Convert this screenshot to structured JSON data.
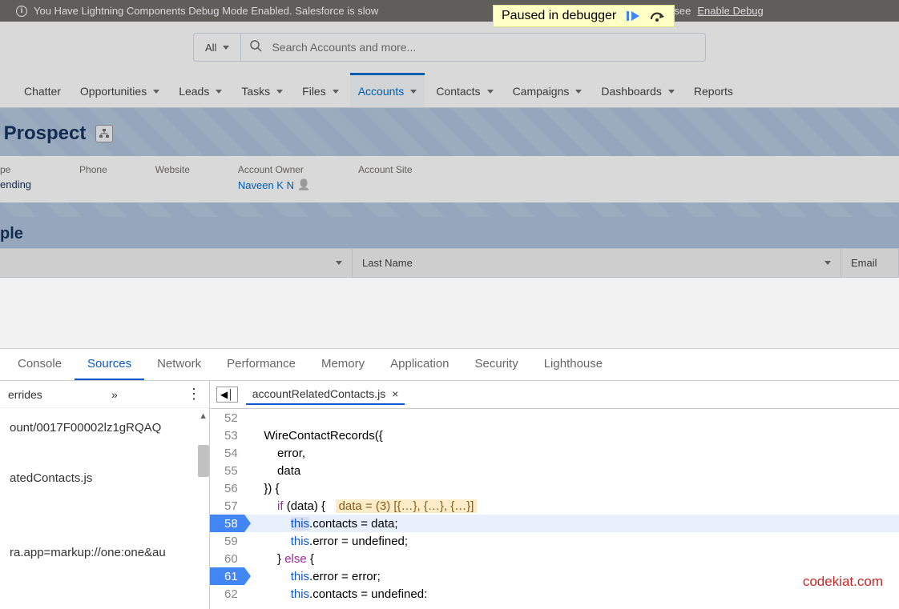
{
  "banner": {
    "text_left": "You Have Lightning Components Debug Mode Enabled. Salesforce is slow",
    "text_right": "w to disable it, or see",
    "link": "Enable Debug"
  },
  "debugger": {
    "label": "Paused in debugger"
  },
  "search": {
    "scope": "All",
    "placeholder": "Search Accounts and more..."
  },
  "nav": {
    "items": [
      "Chatter",
      "Opportunities",
      "Leads",
      "Tasks",
      "Files",
      "Accounts",
      "Contacts",
      "Campaigns",
      "Dashboards",
      "Reports"
    ],
    "active": "Accounts"
  },
  "record": {
    "title_suffix": "t Prospect",
    "details": [
      {
        "label": "pe",
        "value": "ending"
      },
      {
        "label": "Phone",
        "value": ""
      },
      {
        "label": "Website",
        "value": ""
      },
      {
        "label": "Account Owner",
        "value": "Naveen K N",
        "link": true
      },
      {
        "label": "Account Site",
        "value": ""
      }
    ]
  },
  "related": {
    "title_suffix": "ple",
    "columns": [
      "",
      "Last Name",
      "Email"
    ]
  },
  "devtools": {
    "tabs": [
      "Console",
      "Sources",
      "Network",
      "Performance",
      "Memory",
      "Application",
      "Security",
      "Lighthouse"
    ],
    "active_tab": "Sources",
    "sidebar": {
      "header": "errides",
      "items": [
        "ount/0017F00002lz1gRQAQ",
        "atedContacts.js",
        "ra.app=markup://one:one&au"
      ]
    },
    "file": {
      "name": "accountRelatedContacts.js"
    },
    "code": {
      "start": 52,
      "breakpoints": [
        58,
        61
      ],
      "current": 58,
      "inline_eval": "data = (3) [{…}, {…}, {…}]",
      "lines": [
        "",
        "    WireContactRecords({",
        "        error,",
        "        data",
        "    }) {",
        "        if (data) {   ",
        "            this.contacts = data;",
        "            this.error = undefined;",
        "        } else {",
        "            this.error = error;",
        "            this.contacts = undefined:"
      ]
    }
  },
  "watermark": "codekiat.com"
}
